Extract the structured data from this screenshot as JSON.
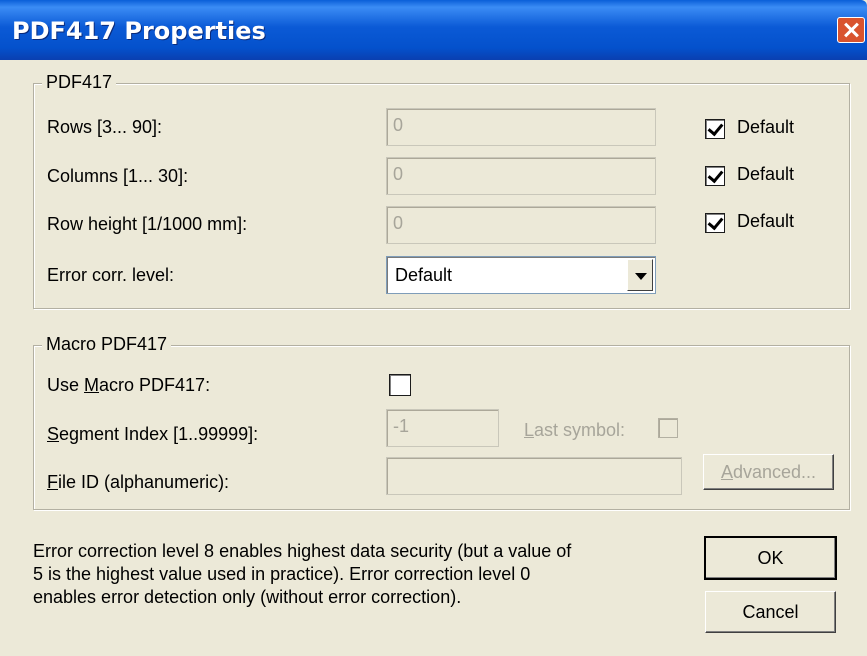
{
  "window": {
    "title": "PDF417 Properties"
  },
  "pdf417_group": {
    "legend": "PDF417",
    "rows": {
      "label": "Rows [3... 90]:",
      "value": "0",
      "default_label": "Default",
      "default_checked": true
    },
    "columns": {
      "label": "Columns [1... 30]:",
      "value": "0",
      "default_label": "Default",
      "default_checked": true
    },
    "row_height": {
      "label": "Row height [1/1000 mm]:",
      "value": "0",
      "default_label": "Default",
      "default_checked": true
    },
    "error_level": {
      "label": "Error corr. level:",
      "selected": "Default"
    }
  },
  "macro_group": {
    "legend": "Macro PDF417",
    "use_macro": {
      "label_pre": "Use ",
      "label_accel": "M",
      "label_post": "acro PDF417:",
      "checked": false
    },
    "segment_index": {
      "label_accel": "S",
      "label_post": "egment Index [1..99999]:",
      "value": "-1"
    },
    "last_symbol": {
      "label_accel": "L",
      "label_post": "ast symbol:",
      "checked": false
    },
    "file_id": {
      "label_accel": "F",
      "label_post": "ile ID (alphanumeric):",
      "value": ""
    },
    "advanced": {
      "label_accel": "A",
      "label_post": "dvanced..."
    }
  },
  "info_text_lines": [
    "Error correction level 8 enables highest data security (but a value of",
    "5 is the highest value used in practice). Error correction level 0",
    "enables error detection only (without error correction)."
  ],
  "buttons": {
    "ok": "OK",
    "cancel": "Cancel"
  }
}
